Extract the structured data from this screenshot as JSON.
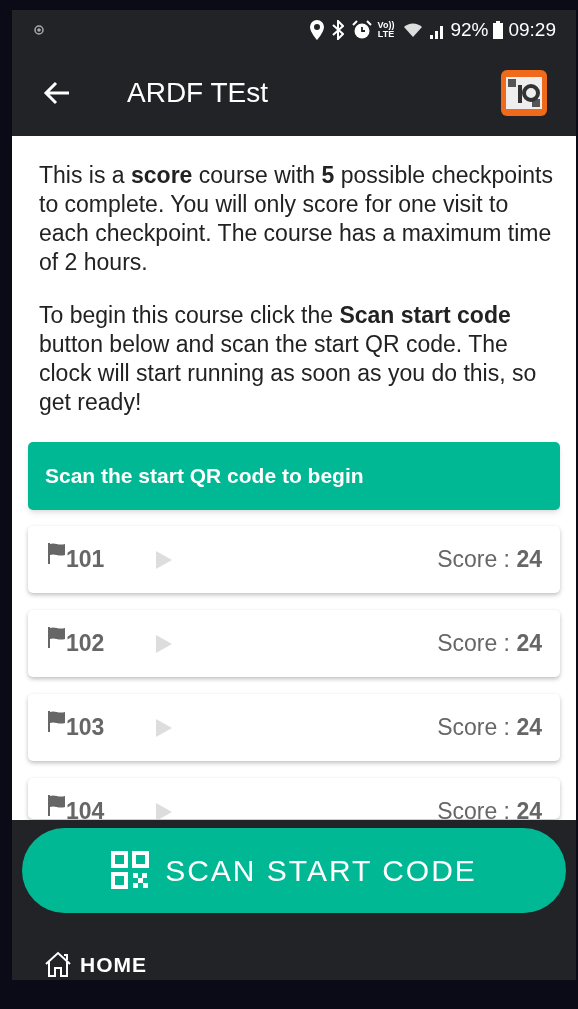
{
  "status_bar": {
    "battery": "92%",
    "time": "09:29",
    "network": [
      "Vo))",
      "LTE"
    ]
  },
  "app_bar": {
    "title": "ARDF TEst"
  },
  "intro": [
    "This is a **score** course with **5** possible checkpoints to complete. You will only score for one visit to each checkpoint. The course has a maximum time of 2 hours.",
    "To begin this course click the **Scan start code** button below and scan the start QR code. The clock will start running as soon as you do this, so get ready!"
  ],
  "banner": "Scan the start QR code to begin",
  "checkpoints": [
    {
      "number": "101",
      "score": "Score : **24**"
    },
    {
      "number": "102",
      "score": "Score : **24**"
    },
    {
      "number": "103",
      "score": "Score : **24**"
    },
    {
      "number": "104",
      "score": "Score : **24**"
    }
  ],
  "scan_button": "SCAN START CODE",
  "home_button": "HOME"
}
